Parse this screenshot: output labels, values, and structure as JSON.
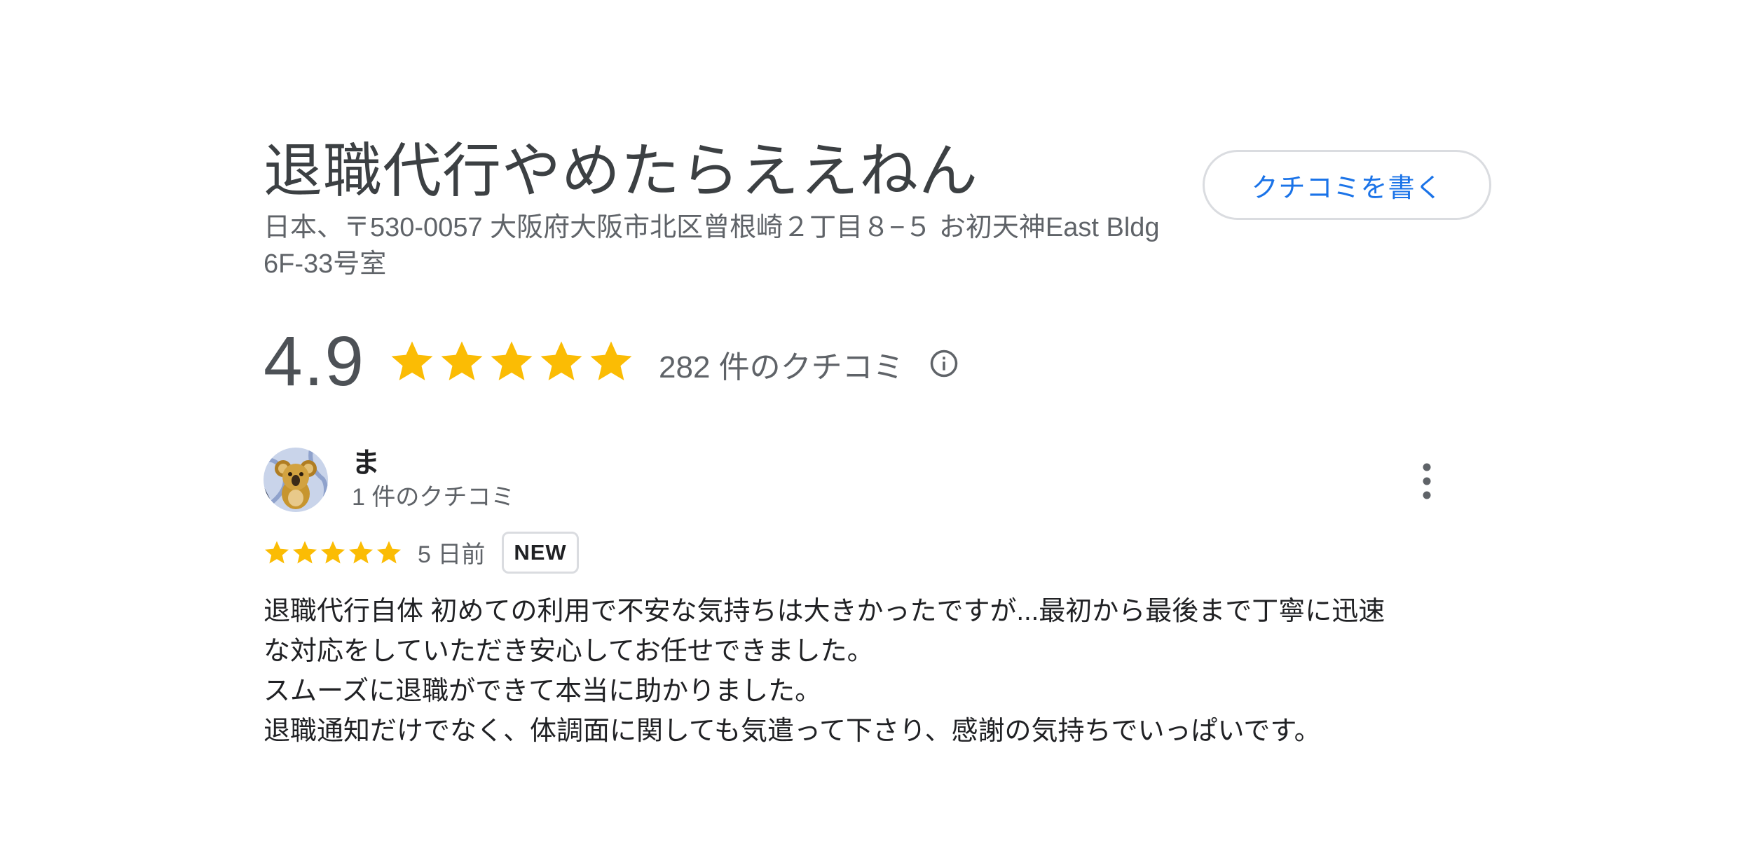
{
  "place": {
    "title": "退職代行やめたらええねん",
    "address_line1": "日本、〒530-0057 大阪府大阪市北区曾根崎２丁目８−５ お初天神East Bldg",
    "address_line2": "6F-33号室",
    "write_review_label": "クチコミを書く"
  },
  "rating": {
    "score": "4.9",
    "stars": 5,
    "count_label": "282 件のクチコミ",
    "info_icon": "info-icon",
    "star_color": "#fbbc04"
  },
  "review": {
    "reviewer_name": "ま",
    "reviewer_meta": "1 件のクチコミ",
    "avatar_icon": "koala-avatar",
    "stars": 5,
    "date": "5 日前",
    "badge": "NEW",
    "more_icon": "more-vert-icon",
    "text_lines": [
      "退職代行自体 初めての利用で不安な気持ちは大きかったですが...最初から最後まで丁寧に迅速",
      "な対応をしていただき安心してお任せできました。",
      "スムーズに退職ができて本当に助かりました。",
      "退職通知だけでなく、体調面に関しても気遣って下さり、感謝の気持ちでいっぱいです。"
    ]
  },
  "colors": {
    "accent": "#1a73e8",
    "text_primary": "#202124",
    "text_secondary": "#5f6368"
  }
}
